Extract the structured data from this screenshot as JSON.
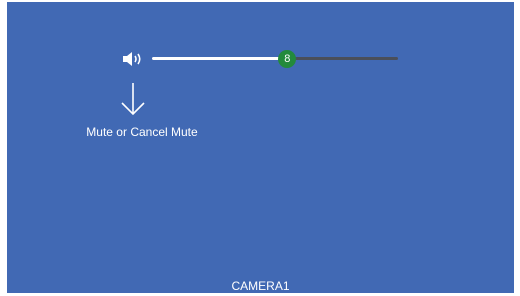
{
  "volume": {
    "icon": "speaker-volume-icon",
    "level": 8,
    "fraction": 0.55,
    "level_label": "8"
  },
  "hint": {
    "arrow_icon": "down-arrow-icon",
    "label": "Mute or Cancel Mute"
  },
  "camera": {
    "label": "CAMERA1"
  },
  "colors": {
    "background": "#4169b4",
    "slider_filled": "#ffffff",
    "slider_empty": "#4a4f5a",
    "thumb": "#238a3c",
    "text": "#ffffff"
  }
}
